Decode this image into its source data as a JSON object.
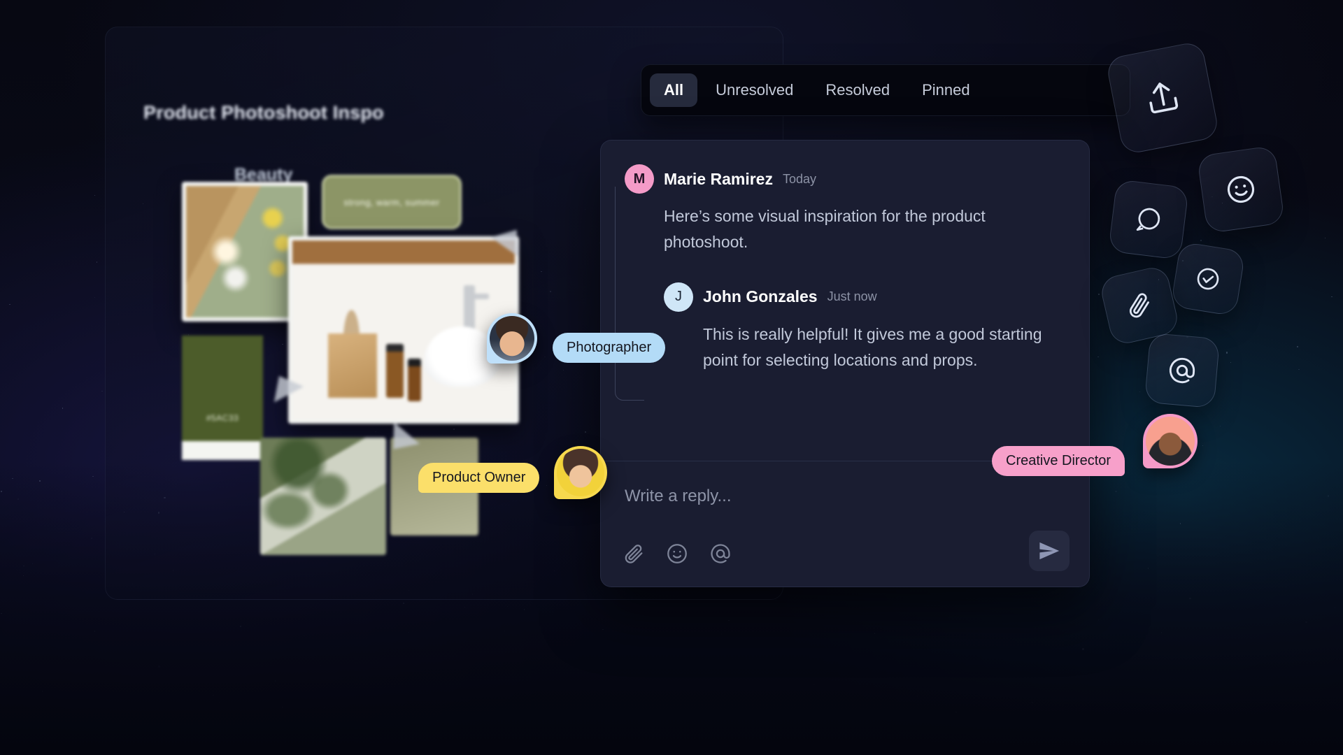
{
  "board": {
    "title": "Product Photoshoot Inspo",
    "subtitle": "Beauty",
    "sticky_note": "strong, warm, summer",
    "color_swatch_hex": "#5AC33"
  },
  "tabs": [
    {
      "label": "All",
      "active": true
    },
    {
      "label": "Unresolved",
      "active": false
    },
    {
      "label": "Resolved",
      "active": false
    },
    {
      "label": "Pinned",
      "active": false
    }
  ],
  "thread": {
    "root": {
      "avatar_initial": "M",
      "avatar_color": "#f49bc8",
      "author": "Marie Ramirez",
      "timestamp": "Today",
      "message": "Here’s some visual inspiration for the product photoshoot."
    },
    "reply": {
      "avatar_initial": "J",
      "avatar_color": "#cfe6f7",
      "author": "John Gonzales",
      "timestamp": "Just now",
      "message": "This is really helpful!  It gives me a good starting point for selecting locations and props."
    }
  },
  "composer": {
    "placeholder": "Write a reply...",
    "icons": [
      "attach-icon",
      "emoji-icon",
      "mention-icon"
    ],
    "send_label": "send-icon"
  },
  "toolbar": [
    {
      "icon": "upload-icon"
    },
    {
      "icon": "comment-icon"
    },
    {
      "icon": "emoji-icon"
    },
    {
      "icon": "check-icon"
    },
    {
      "icon": "attach-icon"
    },
    {
      "icon": "mention-icon"
    }
  ],
  "presence": [
    {
      "role": "Photographer",
      "color": "#b3dbf7",
      "ring": "#bfe0fa"
    },
    {
      "role": "Product Owner",
      "color": "#fbdf6a",
      "ring": "#f7d94e"
    },
    {
      "role": "Creative Director",
      "color": "#f7a0ca",
      "ring": "#f59ac8"
    }
  ]
}
